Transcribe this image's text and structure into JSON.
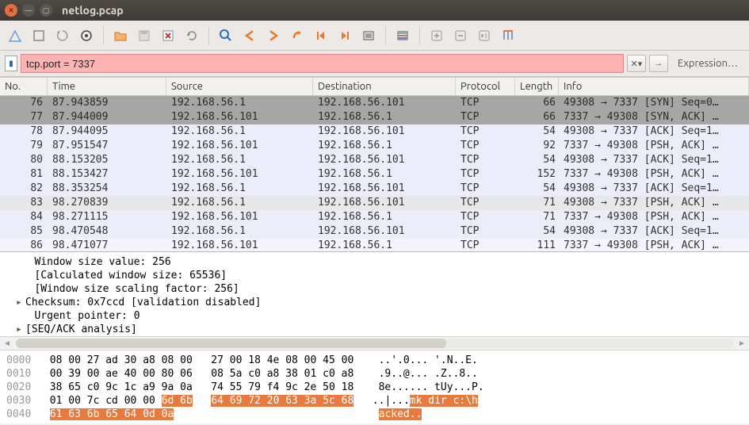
{
  "window": {
    "title": "netlog.pcap"
  },
  "filter": {
    "value": "tcp.port = 7337",
    "expression_label": "Expression…"
  },
  "table": {
    "columns": [
      "No.",
      "Time",
      "Source",
      "Destination",
      "Protocol",
      "Length",
      "Info"
    ],
    "rows": [
      {
        "no": "76",
        "time": "87.943859",
        "src": "192.168.56.1",
        "dst": "192.168.56.101",
        "proto": "TCP",
        "len": "66",
        "info": "49308 → 7337 [SYN] Seq=0…",
        "cls": "r0"
      },
      {
        "no": "77",
        "time": "87.944009",
        "src": "192.168.56.101",
        "dst": "192.168.56.1",
        "proto": "TCP",
        "len": "66",
        "info": "7337 → 49308 [SYN, ACK] …",
        "cls": "r1"
      },
      {
        "no": "78",
        "time": "87.944095",
        "src": "192.168.56.1",
        "dst": "192.168.56.101",
        "proto": "TCP",
        "len": "54",
        "info": "49308 → 7337 [ACK] Seq=1…",
        "cls": "light"
      },
      {
        "no": "79",
        "time": "87.951547",
        "src": "192.168.56.101",
        "dst": "192.168.56.1",
        "proto": "TCP",
        "len": "92",
        "info": "7337 → 49308 [PSH, ACK] …",
        "cls": "light"
      },
      {
        "no": "80",
        "time": "88.153205",
        "src": "192.168.56.1",
        "dst": "192.168.56.101",
        "proto": "TCP",
        "len": "54",
        "info": "49308 → 7337 [ACK] Seq=1…",
        "cls": "light"
      },
      {
        "no": "81",
        "time": "88.153427",
        "src": "192.168.56.101",
        "dst": "192.168.56.1",
        "proto": "TCP",
        "len": "152",
        "info": "7337 → 49308 [PSH, ACK] …",
        "cls": "light"
      },
      {
        "no": "82",
        "time": "88.353254",
        "src": "192.168.56.1",
        "dst": "192.168.56.101",
        "proto": "TCP",
        "len": "54",
        "info": "49308 → 7337 [ACK] Seq=1…",
        "cls": "light"
      },
      {
        "no": "83",
        "time": "98.270839",
        "src": "192.168.56.1",
        "dst": "192.168.56.101",
        "proto": "TCP",
        "len": "71",
        "info": "49308 → 7337 [PSH, ACK] …",
        "cls": "gray"
      },
      {
        "no": "84",
        "time": "98.271115",
        "src": "192.168.56.101",
        "dst": "192.168.56.1",
        "proto": "TCP",
        "len": "71",
        "info": "7337 → 49308 [PSH, ACK] …",
        "cls": "light"
      },
      {
        "no": "85",
        "time": "98.470548",
        "src": "192.168.56.1",
        "dst": "192.168.56.101",
        "proto": "TCP",
        "len": "54",
        "info": "49308 → 7337 [ACK] Seq=1…",
        "cls": "light"
      },
      {
        "no": "86",
        "time": "98.471077",
        "src": "192.168.56.101",
        "dst": "192.168.56.1",
        "proto": "TCP",
        "len": "111",
        "info": "7337 → 49308 [PSH, ACK] …",
        "cls": "verylight"
      }
    ]
  },
  "details": {
    "lines": [
      "   Window size value: 256",
      "   [Calculated window size: 65536]",
      "   [Window size scaling factor: 256]",
      "   Checksum: 0x7ccd [validation disabled]",
      "   Urgent pointer: 0",
      "   [SEQ/ACK analysis]"
    ],
    "expandable_indices": [
      3,
      5
    ]
  },
  "hex": {
    "lines": [
      {
        "off": "0000",
        "b1": "08 00 27 ad 30 a8 08 00",
        "b2": "27 00 18 4e 08 00 45 00",
        "asc": "..'.0... '.N..E."
      },
      {
        "off": "0010",
        "b1": "00 39 00 ae 40 00 80 06",
        "b2": "08 5a c0 a8 38 01 c0 a8",
        "asc": ".9..@... .Z..8.."
      },
      {
        "off": "0020",
        "b1": "38 65 c0 9c 1c a9 9a 0a",
        "b2": "74 55 79 f4 9c 2e 50 18",
        "asc": "8e...... tUy...P."
      },
      {
        "off": "0030",
        "b1": "01 00 7c cd 00 00 ",
        "b1_hl": "6d 6b",
        "b2_hl": "64 69 72 20 63 3a 5c 68",
        "asc_pre": "..|...",
        "asc_hl": "mk dir c:\\h"
      },
      {
        "off": "0040",
        "b1_hl2": "61 63 6b 65 64 0d 0a",
        "asc_hl2": "acked.."
      }
    ]
  }
}
